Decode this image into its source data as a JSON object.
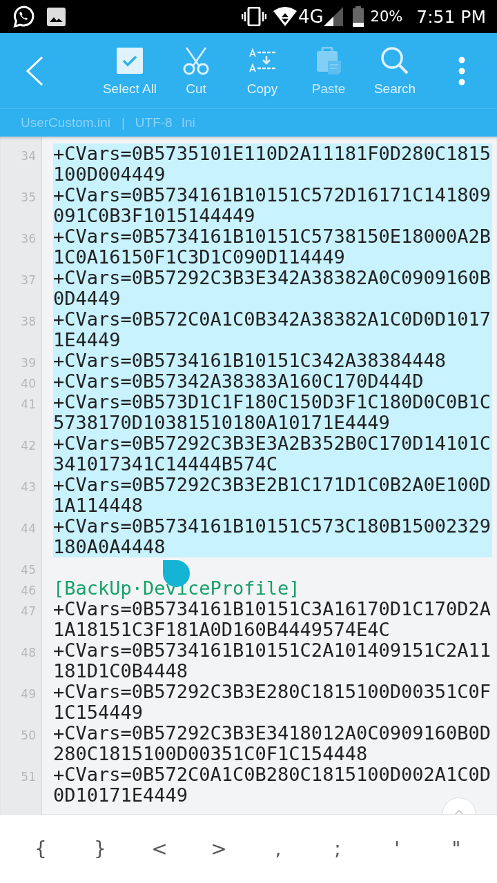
{
  "status_bar": {
    "battery": "20%",
    "network": "4G",
    "time": "7:51 PM"
  },
  "toolbar": {
    "actions": [
      {
        "label": "Select All",
        "disabled": false,
        "kind": "select-all"
      },
      {
        "label": "Cut",
        "disabled": false,
        "kind": "cut"
      },
      {
        "label": "Copy",
        "disabled": false,
        "kind": "copy"
      },
      {
        "label": "Paste",
        "disabled": true,
        "kind": "paste"
      },
      {
        "label": "Search",
        "disabled": false,
        "kind": "search"
      }
    ]
  },
  "file_bar": {
    "filename": "UserCustom.ini",
    "separator": "|",
    "encoding": "UTF-8",
    "syntax": "Ini"
  },
  "editor": {
    "lines": [
      {
        "number": "34",
        "kind": "code",
        "selected": true,
        "text": "+CVars=0B5735101E110D2A11181F0D280C1815100D004449"
      },
      {
        "number": "35",
        "kind": "code",
        "selected": true,
        "text": "+CVars=0B5734161B10151C572D16171C141809091C0B3F1015144449"
      },
      {
        "number": "36",
        "kind": "code",
        "selected": true,
        "text": "+CVars=0B5734161B10151C5738150E18000A2B1C0A16150F1C3D1C090D114449"
      },
      {
        "number": "37",
        "kind": "code",
        "selected": true,
        "text": "+CVars=0B57292C3B3E342A38382A0C0909160B0D4449"
      },
      {
        "number": "38",
        "kind": "code",
        "selected": true,
        "text": "+CVars=0B572C0A1C0B342A38382A1C0D0D10171E4449"
      },
      {
        "number": "39",
        "kind": "code",
        "selected": true,
        "text": "+CVars=0B5734161B10151C342A38384448"
      },
      {
        "number": "40",
        "kind": "code",
        "selected": true,
        "text": "+CVars=0B57342A38383A160C170D444D"
      },
      {
        "number": "41",
        "kind": "code",
        "selected": true,
        "text": "+CVars=0B573D1C1F180C150D3F1C180D0C0B1C5738170D10381510180A10171E4449"
      },
      {
        "number": "42",
        "kind": "code",
        "selected": true,
        "text": "+CVars=0B57292C3B3E3A2B352B0C170D14101C341017341C14444B574C"
      },
      {
        "number": "43",
        "kind": "code",
        "selected": true,
        "text": "+CVars=0B57292C3B3E2B1C171D1C0B2A0E100D1A114448"
      },
      {
        "number": "44",
        "kind": "code",
        "selected": true,
        "text": "+CVars=0B5734161B10151C573C180B15002329180A0A4448"
      },
      {
        "number": "45",
        "kind": "blank",
        "selected": false
      },
      {
        "number": "46",
        "kind": "section",
        "selected": false,
        "text": "[BackUp·DeviceProfile]"
      },
      {
        "number": "47",
        "kind": "code",
        "selected": false,
        "text": "+CVars=0B5734161B10151C3A16170D1C170D2A1A18151C3F181A0D160B4449574E4C"
      },
      {
        "number": "48",
        "kind": "code",
        "selected": false,
        "text": "+CVars=0B5734161B10151C2A101409151C2A11181D1C0B4448"
      },
      {
        "number": "49",
        "kind": "code",
        "selected": false,
        "text": "+CVars=0B57292C3B3E280C1815100D00351C0F1C154449"
      },
      {
        "number": "50",
        "kind": "code",
        "selected": false,
        "text": "+CVars=0B57292C3B3E3418012A0C0909160B0D280C1815100D00351C0F1C154448"
      },
      {
        "number": "51",
        "kind": "code",
        "selected": false,
        "text": "+CVars=0B572C0A1C0B280C1815100D002A1C0D0D10171E4449"
      }
    ]
  },
  "symbol_keys": [
    "{",
    "}",
    "<",
    ">",
    ",",
    ";",
    "'",
    "\""
  ]
}
